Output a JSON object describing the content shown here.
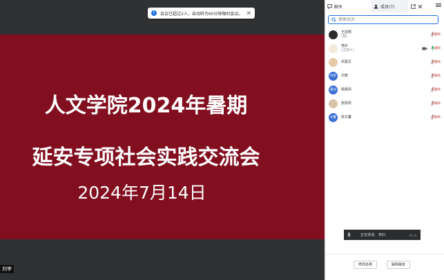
{
  "toast": {
    "text": "会议已超过2人，自动转为60分钟限时会议。",
    "info_glyph": "i",
    "close_glyph": "✕"
  },
  "slide": {
    "title_line1": "人文学院2024年暑期",
    "title_line2": "延安专项社会实践交流会",
    "date": "2024年7月14日",
    "background_color": "#820f20"
  },
  "video": {
    "speaker_label": "刘李"
  },
  "panel": {
    "tabs": {
      "chat_label": "聊天",
      "members_label": "成员(7)"
    },
    "search_placeholder": "搜索成员",
    "members": [
      {
        "name": "王前邦",
        "sub": "(我)",
        "avatar_text": "",
        "avatar_color": "#2b2b2b",
        "mic": "muted",
        "camera": false,
        "action": "删除"
      },
      {
        "name": "李红",
        "sub": "(主持人)",
        "avatar_text": "",
        "avatar_color": "#f4e9d9",
        "mic": "active",
        "camera": true,
        "action": "删除"
      },
      {
        "name": "邓嘉文",
        "sub": "",
        "avatar_text": "",
        "avatar_color": "#e8c9a8",
        "mic": "muted",
        "camera": false,
        "action": "删除"
      },
      {
        "name": "刘李",
        "sub": "",
        "avatar_text": "刘李",
        "avatar_color": "#3b6fd4",
        "mic": "muted",
        "camera": false,
        "action": "删除"
      },
      {
        "name": "喻晨凤",
        "sub": "",
        "avatar_text": "晨凤",
        "avatar_color": "#3b6fd4",
        "mic": "muted",
        "camera": false,
        "action": "删除"
      },
      {
        "name": "张彤彤",
        "sub": "",
        "avatar_text": "",
        "avatar_color": "#d9c3a8",
        "mic": "muted",
        "camera": false,
        "action": "删除"
      },
      {
        "name": "张文馨",
        "sub": "",
        "avatar_text": "文馨",
        "avatar_color": "#3b6fd4",
        "mic": "muted",
        "camera": false,
        "action": "删除"
      }
    ],
    "now_speaking": {
      "label": "正在讲话:",
      "name": "李红;"
    },
    "footer": {
      "rename_label": "修改名称",
      "unmute_label": "解除静音"
    }
  },
  "colors": {
    "accent": "#1d6ce5",
    "muted_mic": "#d9534f",
    "active_mic": "#2fb463",
    "action_text": "#c0392b"
  }
}
